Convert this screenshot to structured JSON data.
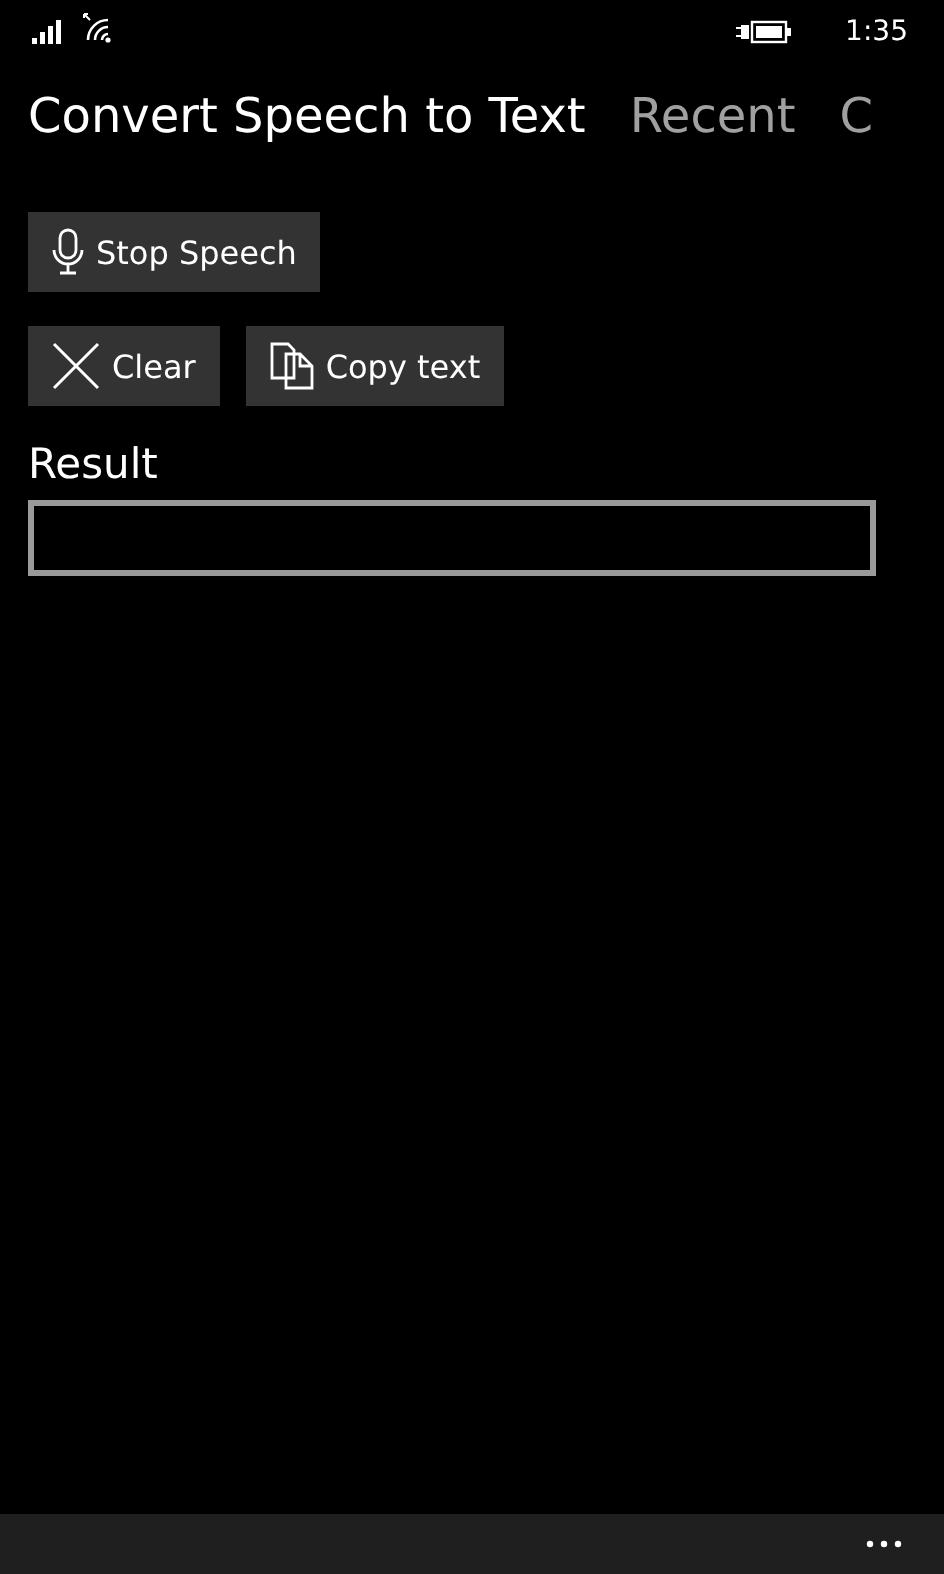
{
  "status_bar": {
    "time": "1:35"
  },
  "pivot": [
    {
      "label": "Convert Speech to Text",
      "selected": true
    },
    {
      "label": "Recent",
      "selected": false
    },
    {
      "label": "C",
      "selected": false
    }
  ],
  "button_rows": [
    [
      {
        "kind": "mic",
        "label": "Stop Speech"
      }
    ],
    [
      {
        "kind": "clear",
        "label": "Clear"
      },
      {
        "kind": "copy",
        "label": "Copy text"
      }
    ]
  ],
  "result": {
    "label": "Result"
  }
}
